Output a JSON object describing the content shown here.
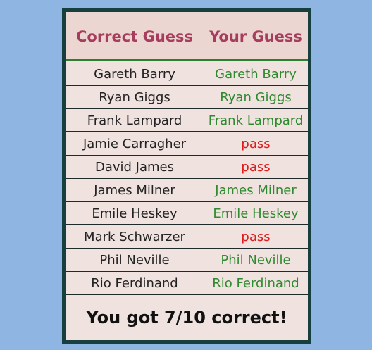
{
  "header": {
    "col_correct": "Correct Guess",
    "col_yours": "Your Guess"
  },
  "rows": [
    {
      "correct": "Gareth Barry",
      "yours": "Gareth Barry",
      "status": "ok"
    },
    {
      "correct": "Ryan Giggs",
      "yours": "Ryan Giggs",
      "status": "ok"
    },
    {
      "correct": "Frank Lampard",
      "yours": "Frank Lampard",
      "status": "ok"
    },
    {
      "correct": "Jamie Carragher",
      "yours": "pass",
      "status": "pass"
    },
    {
      "correct": "David James",
      "yours": "pass",
      "status": "pass"
    },
    {
      "correct": "James Milner",
      "yours": "James Milner",
      "status": "ok"
    },
    {
      "correct": "Emile Heskey",
      "yours": "Emile Heskey",
      "status": "ok"
    },
    {
      "correct": "Mark Schwarzer",
      "yours": "pass",
      "status": "pass"
    },
    {
      "correct": "Phil Neville",
      "yours": "Phil Neville",
      "status": "ok"
    },
    {
      "correct": "Rio Ferdinand",
      "yours": "Rio Ferdinand",
      "status": "ok"
    }
  ],
  "result": {
    "text": "You got 7/10 correct!"
  },
  "colors": {
    "page_background": "#8fb6e2",
    "card_border": "#173f3f",
    "header_text": "#a73d5e",
    "correct_guess": "#2f8a2f",
    "pass": "#e01b1b"
  }
}
